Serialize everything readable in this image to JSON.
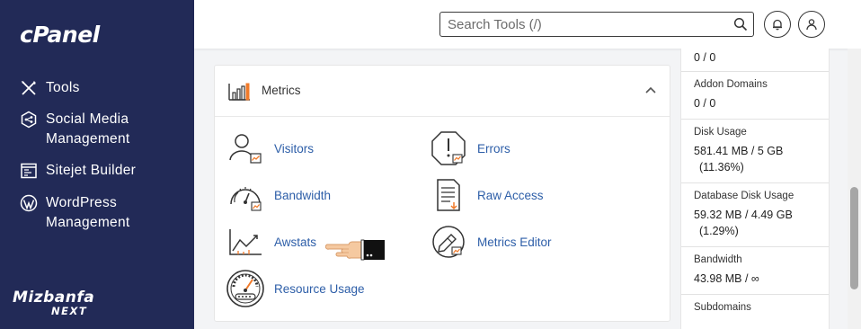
{
  "sidebar": {
    "brand": "cPanel",
    "items": [
      {
        "label": "Tools",
        "icon": "tools-icon"
      },
      {
        "label": "Social Media Management",
        "icon": "social-media-icon"
      },
      {
        "label": "Sitejet Builder",
        "icon": "sitejet-icon"
      },
      {
        "label": "WordPress Management",
        "icon": "wordpress-icon"
      }
    ],
    "footer_logo": {
      "line1": "Mizbanfa",
      "line2": "NEXT"
    }
  },
  "header": {
    "search_placeholder": "Search Tools (/)",
    "search_icon": "search-icon",
    "notifications_icon": "bell-icon",
    "user_icon": "user-icon"
  },
  "metrics": {
    "title": "Metrics",
    "tools": [
      {
        "label": "Visitors",
        "icon": "visitors-icon"
      },
      {
        "label": "Errors",
        "icon": "errors-icon"
      },
      {
        "label": "Bandwidth",
        "icon": "bandwidth-icon"
      },
      {
        "label": "Raw Access",
        "icon": "raw-access-icon"
      },
      {
        "label": "Awstats",
        "icon": "awstats-icon"
      },
      {
        "label": "Metrics Editor",
        "icon": "metrics-editor-icon"
      },
      {
        "label": "Resource Usage",
        "icon": "resource-usage-icon"
      }
    ]
  },
  "stats": {
    "top_value": "0 / 0",
    "rows": [
      {
        "label": "Addon Domains",
        "value": "0 / 0",
        "sub": ""
      },
      {
        "label": "Disk Usage",
        "value": "581.41 MB / 5 GB",
        "sub": "(11.36%)"
      },
      {
        "label": "Database Disk Usage",
        "value": "59.32 MB / 4.49 GB",
        "sub": "(1.29%)"
      },
      {
        "label": "Bandwidth",
        "value": "43.98 MB / ∞",
        "sub": ""
      },
      {
        "label": "Subdomains",
        "value": "",
        "sub": ""
      }
    ]
  },
  "colors": {
    "sidebar_bg": "#222a57",
    "link": "#2d5ea8",
    "accent_orange": "#f07a2a"
  }
}
